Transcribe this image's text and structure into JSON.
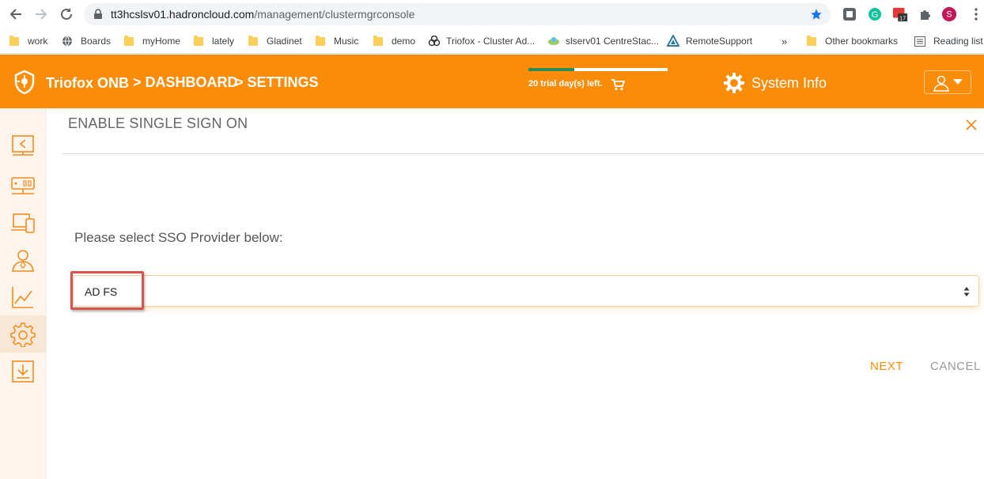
{
  "browser": {
    "url_host": "tt3hcslsv01.hadroncloud.com",
    "url_path": "/management/clustermgrconsole",
    "profile_initial": "S",
    "calendar_badge": "17"
  },
  "bookmarks": [
    {
      "label": "work",
      "icon": "folder-icon"
    },
    {
      "label": "Boards",
      "icon": "globe-icon"
    },
    {
      "label": "myHome",
      "icon": "folder-icon"
    },
    {
      "label": "lately",
      "icon": "folder-icon"
    },
    {
      "label": "Gladinet",
      "icon": "folder-icon"
    },
    {
      "label": "Music",
      "icon": "folder-icon"
    },
    {
      "label": "demo",
      "icon": "folder-icon"
    },
    {
      "label": "Triofox - Cluster Ad...",
      "icon": "triofox-icon"
    },
    {
      "label": "slserv01 CentreStac...",
      "icon": "centrestack-icon"
    },
    {
      "label": "RemoteSupport",
      "icon": "remote-support-icon"
    }
  ],
  "bookmarks_more": "»",
  "other_bookmarks": "Other bookmarks",
  "reading_list": "Reading list",
  "header": {
    "brand": "Triofox ONB",
    "crumb1": "> DASHBOARD",
    "crumb2": "> SETTINGS",
    "trial_text": "20 trial day(s) left.",
    "trial_progress": 0.33,
    "system_info": "System Info",
    "bg_color": "#fb8c08"
  },
  "sidebar": [
    {
      "name": "sidebar-item-shares",
      "icon": "shared-folder-icon"
    },
    {
      "name": "sidebar-item-cluster",
      "icon": "server-icon"
    },
    {
      "name": "sidebar-item-devices",
      "icon": "devices-icon"
    },
    {
      "name": "sidebar-item-users",
      "icon": "user-icon"
    },
    {
      "name": "sidebar-item-reports",
      "icon": "chart-icon"
    },
    {
      "name": "sidebar-item-settings",
      "icon": "gear-icon",
      "active": true
    },
    {
      "name": "sidebar-item-downloads",
      "icon": "download-icon"
    }
  ],
  "panel": {
    "title": "ENABLE SINGLE SIGN ON",
    "prompt": "Please select SSO Provider below:",
    "sso_provider_selected": "AD FS",
    "next_label": "NEXT",
    "cancel_label": "CANCEL"
  }
}
